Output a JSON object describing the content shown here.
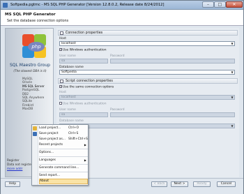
{
  "window": {
    "title": "Softpedia.pgtmc - MS SQL PHP Generator [Version 12.8.0.2, Release date 8/24/2012]",
    "min": "–",
    "max": "□",
    "close": "✕"
  },
  "header": {
    "title": "MS SQL PHP Generator",
    "subtitle": "Set the database connection options"
  },
  "left": {
    "company": "SQL Maestro Group",
    "tagline": "(The slowest DBA is it)",
    "products": [
      "MySQL",
      "Oracle",
      "MS SQL Server",
      "PostgreSQL",
      "DB2",
      "SQL Anywhere",
      "SQLite",
      "Firebird",
      "MaxDB"
    ],
    "selected": "MS SQL Server",
    "bottom1": "Register",
    "bottom2": "Data not registered",
    "link": "more addr"
  },
  "connection": {
    "section": "Connection properties",
    "host_label": "Host",
    "host_value": "localhost",
    "winauth_label": "Use Windows authentication",
    "user_label": "User name",
    "user_value": "sa",
    "pass_label": "Password",
    "db_label": "Database name",
    "db_value": "Softpedia"
  },
  "script": {
    "section": "Script connection properties",
    "same_label": "Use the same connection options",
    "host_label": "Host",
    "host_value": "localhost",
    "winauth_label": "Use Windows authentication",
    "user_label": "User name",
    "user_value": "sa",
    "pass_label": "Password",
    "db_label": "Database name"
  },
  "footer": {
    "help": "Help",
    "back": "< Back",
    "next": "Next >",
    "ready": "Ready",
    "cancel": "Cancel"
  },
  "menu": {
    "items": [
      {
        "label": "Load project...",
        "shortcut": "Ctrl+O"
      },
      {
        "label": "Save project",
        "shortcut": "Ctrl+S"
      },
      {
        "label": "Save project as...",
        "shortcut": "Shift+Ctrl+S"
      },
      {
        "label": "Recent projects",
        "shortcut": ""
      },
      {
        "label": "Options...",
        "shortcut": ""
      },
      {
        "label": "Languages",
        "shortcut": ""
      },
      {
        "label": "Generate command line...",
        "shortcut": ""
      },
      {
        "label": "Send report...",
        "shortcut": ""
      },
      {
        "label": "About",
        "shortcut": ""
      }
    ],
    "highlighted": "About"
  },
  "colors": {
    "accent": "#3a6fb5",
    "highlight": "#f9e3a6"
  }
}
